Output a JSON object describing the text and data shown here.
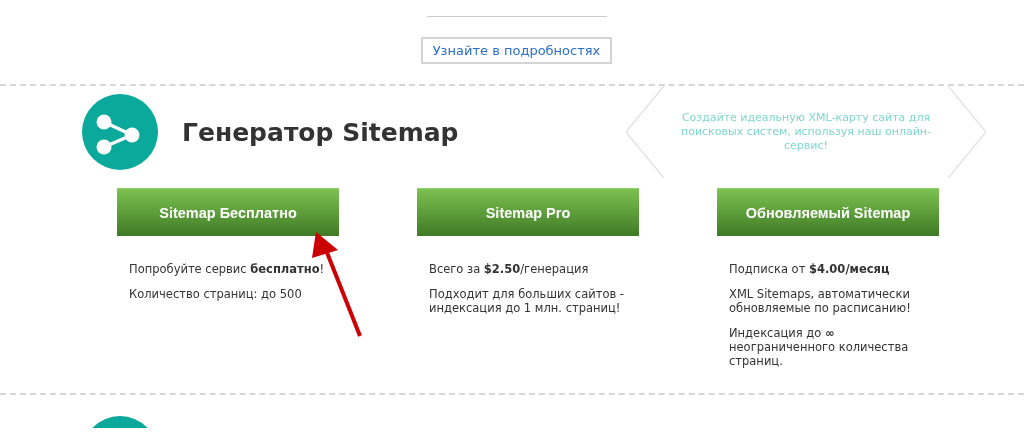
{
  "more_button": {
    "label": "Узнайте в подробностях"
  },
  "section": {
    "title": "Генератор Sitemap",
    "tagline": "Создайте идеальную XML-карту сайта для поисковых систем, используя наш онлайн-сервис!",
    "plans": [
      {
        "button": "Sitemap Бесплатно",
        "pointed": true,
        "paragraphs": [
          "Попробуйте сервис **бесплатно**!",
          "Количество страниц: до 500"
        ]
      },
      {
        "button": "Sitemap Pro",
        "pointed": false,
        "paragraphs": [
          "Всего за **$2.50**/генерация",
          "Подходит для больших сайтов - индексация до 1 млн. страниц!"
        ]
      },
      {
        "button": "Обновляемый Sitemap",
        "pointed": false,
        "paragraphs": [
          "Подписка от **$4.00/месяц**",
          "XML Sitemaps, автоматически обновляемые по расписанию!",
          "Индексация до **∞** неограниченного количества страниц."
        ]
      }
    ]
  }
}
